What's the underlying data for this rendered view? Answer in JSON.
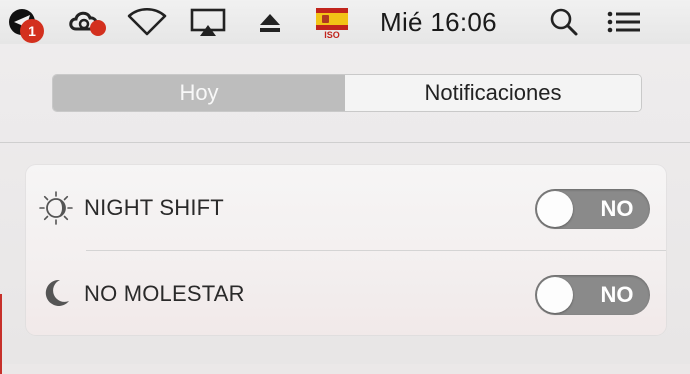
{
  "menubar": {
    "notification_badge": "1",
    "flag_label": "ISO",
    "clock": "Mié 16:06",
    "icons": [
      "telegram-icon",
      "creative-cloud-icon",
      "wifi-icon",
      "airplay-icon",
      "eject-icon",
      "spain-flag-icon",
      "spotlight-search-icon",
      "notification-center-icon"
    ]
  },
  "notification_center": {
    "tabs": [
      {
        "label": "Hoy",
        "selected": true
      },
      {
        "label": "Notificaciones",
        "selected": false
      }
    ],
    "toggles": [
      {
        "label": "NIGHT SHIFT",
        "state": "NO",
        "icon": "night-shift-icon"
      },
      {
        "label": "NO MOLESTAR",
        "state": "NO",
        "icon": "moon-icon"
      }
    ]
  },
  "colors": {
    "badge_red": "#d3301e",
    "toggle_off": "#8a8a8a",
    "selected_tab": "#bdbdbd"
  }
}
